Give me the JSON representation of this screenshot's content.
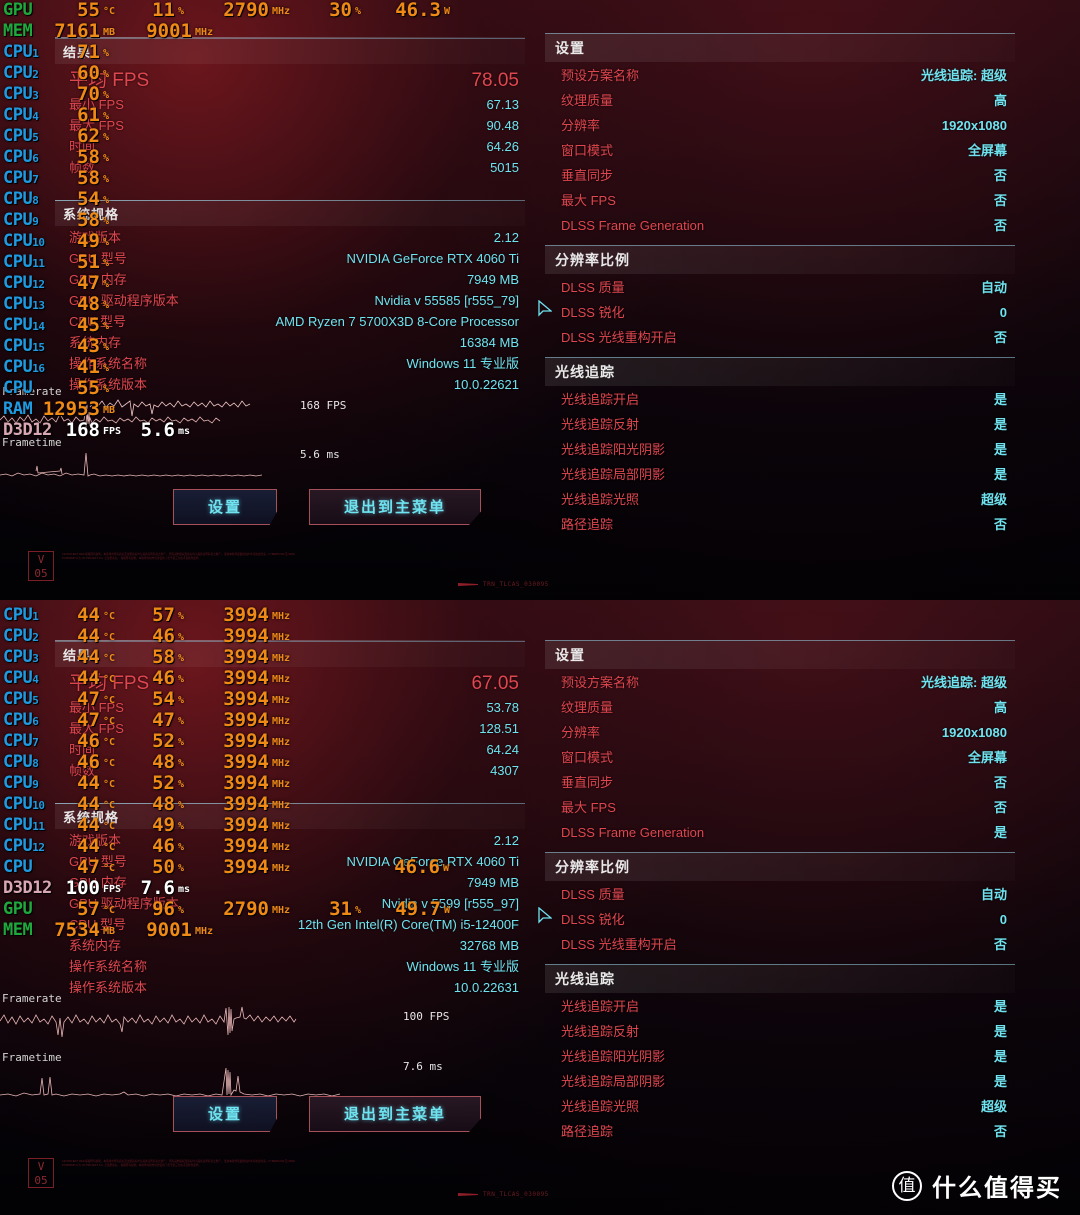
{
  "watermark": {
    "logo_glyph": "值",
    "text": "什么值得买"
  },
  "corner_tag": "TRN_TLCAS_030095",
  "v05_badge": {
    "line1": "V",
    "line2": "05"
  },
  "legal_text": "CD PROJEKT RED 保留所有权利。本游戏中所有商标及注册商标均为其各自所有者之财产。 所有其他版权及商标均为其各自所有者之财产。 使用本软件受最终用户许可协议约束。CYBERPUNK 及 MIKE PONDSMITH 为 CD PROJEKT S.A. 之注册商标。 保留所有权利。本软件的制作包含使用了若干第三方技术及软件组件。",
  "screens": [
    {
      "id": "top",
      "osd": {
        "gpu": {
          "label": "GPU",
          "temp": "55",
          "temp_unit": "°C",
          "load": "11",
          "load_unit": "%",
          "clock": "2790",
          "clock_unit": "MHz",
          "mem_load": "30",
          "mem_load_unit": "%",
          "power": "46.3",
          "power_unit": "W"
        },
        "mem": {
          "label": "MEM",
          "used": "7161",
          "used_unit": "MB",
          "clock": "9001",
          "clock_unit": "MHz"
        },
        "cpu_cores": [
          {
            "label": "CPU",
            "index": "1",
            "value": "71",
            "unit": "%"
          },
          {
            "label": "CPU",
            "index": "2",
            "value": "60",
            "unit": "%"
          },
          {
            "label": "CPU",
            "index": "3",
            "value": "70",
            "unit": "%"
          },
          {
            "label": "CPU",
            "index": "4",
            "value": "61",
            "unit": "%"
          },
          {
            "label": "CPU",
            "index": "5",
            "value": "62",
            "unit": "%"
          },
          {
            "label": "CPU",
            "index": "6",
            "value": "58",
            "unit": "%"
          },
          {
            "label": "CPU",
            "index": "7",
            "value": "58",
            "unit": "%"
          },
          {
            "label": "CPU",
            "index": "8",
            "value": "54",
            "unit": "%"
          },
          {
            "label": "CPU",
            "index": "9",
            "value": "58",
            "unit": "%"
          },
          {
            "label": "CPU",
            "index": "10",
            "value": "49",
            "unit": "%"
          },
          {
            "label": "CPU",
            "index": "11",
            "value": "51",
            "unit": "%"
          },
          {
            "label": "CPU",
            "index": "12",
            "value": "47",
            "unit": "%"
          },
          {
            "label": "CPU",
            "index": "13",
            "value": "48",
            "unit": "%"
          },
          {
            "label": "CPU",
            "index": "14",
            "value": "45",
            "unit": "%"
          },
          {
            "label": "CPU",
            "index": "15",
            "value": "43",
            "unit": "%"
          },
          {
            "label": "CPU",
            "index": "16",
            "value": "41",
            "unit": "%"
          }
        ],
        "cpu_total": {
          "label": "CPU",
          "value": "55",
          "unit": "%"
        },
        "ram": {
          "label": "RAM",
          "value": "12953",
          "unit": "MB"
        },
        "d3d": {
          "label": "D3D12",
          "fps": "168",
          "fps_unit": "FPS",
          "frametime": "5.6",
          "frametime_unit": "ms"
        },
        "framerate_label": "Framerate",
        "frametime_label": "Frametime",
        "framerate_scale": "168 FPS",
        "frametime_scale": "5.6 ms"
      },
      "benchmark": {
        "header": "结果",
        "rows": [
          {
            "k": "平均 FPS",
            "v": "78.05",
            "big": true
          },
          {
            "k": "最小 FPS",
            "v": "67.13",
            "big": false
          },
          {
            "k": "最大 FPS",
            "v": "90.48",
            "big": false
          },
          {
            "k": "时间",
            "v": "64.26",
            "big": false
          },
          {
            "k": "帧数",
            "v": "5015",
            "big": false
          }
        ]
      },
      "system": {
        "header": "系统规格",
        "rows": [
          {
            "k": "游戏版本",
            "v": "2.12"
          },
          {
            "k": "GPU 型号",
            "v": "NVIDIA GeForce RTX 4060 Ti"
          },
          {
            "k": "GPU 内存",
            "v": "7949 MB"
          },
          {
            "k": "GPU 驱动程序版本",
            "v": "Nvidia v 55585 [r555_79]"
          },
          {
            "k": "CPU 型号",
            "v": "AMD Ryzen 7 5700X3D 8-Core Processor"
          },
          {
            "k": "系统内存",
            "v": "16384 MB"
          },
          {
            "k": "操作系统名称",
            "v": "Windows 11 专业版"
          },
          {
            "k": "操作系统版本",
            "v": "10.0.22621"
          }
        ]
      },
      "settings": {
        "header": "设置",
        "rows": [
          {
            "k": "预设方案名称",
            "v": "光线追踪: 超级"
          },
          {
            "k": "纹理质量",
            "v": "高"
          },
          {
            "k": "分辨率",
            "v": "1920x1080"
          },
          {
            "k": "窗口模式",
            "v": "全屏幕"
          },
          {
            "k": "垂直同步",
            "v": "否"
          },
          {
            "k": "最大 FPS",
            "v": "否"
          },
          {
            "k": "DLSS Frame Generation",
            "v": "否"
          }
        ]
      },
      "resolution_scale": {
        "header": "分辨率比例",
        "rows": [
          {
            "k": "DLSS 质量",
            "v": "自动"
          },
          {
            "k": "DLSS 锐化",
            "v": "0"
          },
          {
            "k": "DLSS 光线重构开启",
            "v": "否"
          }
        ]
      },
      "raytracing": {
        "header": "光线追踪",
        "rows": [
          {
            "k": "光线追踪开启",
            "v": "是"
          },
          {
            "k": "光线追踪反射",
            "v": "是"
          },
          {
            "k": "光线追踪阳光阴影",
            "v": "是"
          },
          {
            "k": "光线追踪局部阴影",
            "v": "是"
          },
          {
            "k": "光线追踪光照",
            "v": "超级"
          },
          {
            "k": "路径追踪",
            "v": "否"
          }
        ]
      },
      "buttons": {
        "settings": "设置",
        "exit": "退出到主菜单"
      }
    },
    {
      "id": "bottom",
      "osd": {
        "gpu": {
          "label": "GPU",
          "temp": "57",
          "temp_unit": "°C",
          "load": "96",
          "load_unit": "%",
          "clock": "2790",
          "clock_unit": "MHz",
          "mem_load": "31",
          "mem_load_unit": "%",
          "power": "49.7",
          "power_unit": "W"
        },
        "mem": {
          "label": "MEM",
          "used": "7534",
          "used_unit": "MB",
          "clock": "9001",
          "clock_unit": "MHz"
        },
        "cpu_cores": [
          {
            "label": "CPU",
            "index": "1",
            "temp": "44",
            "temp_unit": "°C",
            "load": "57",
            "load_unit": "%",
            "clock": "3994",
            "clock_unit": "MHz"
          },
          {
            "label": "CPU",
            "index": "2",
            "temp": "44",
            "temp_unit": "°C",
            "load": "46",
            "load_unit": "%",
            "clock": "3994",
            "clock_unit": "MHz"
          },
          {
            "label": "CPU",
            "index": "3",
            "temp": "44",
            "temp_unit": "°C",
            "load": "58",
            "load_unit": "%",
            "clock": "3994",
            "clock_unit": "MHz"
          },
          {
            "label": "CPU",
            "index": "4",
            "temp": "44",
            "temp_unit": "°C",
            "load": "46",
            "load_unit": "%",
            "clock": "3994",
            "clock_unit": "MHz"
          },
          {
            "label": "CPU",
            "index": "5",
            "temp": "47",
            "temp_unit": "°C",
            "load": "54",
            "load_unit": "%",
            "clock": "3994",
            "clock_unit": "MHz"
          },
          {
            "label": "CPU",
            "index": "6",
            "temp": "47",
            "temp_unit": "°C",
            "load": "47",
            "load_unit": "%",
            "clock": "3994",
            "clock_unit": "MHz"
          },
          {
            "label": "CPU",
            "index": "7",
            "temp": "46",
            "temp_unit": "°C",
            "load": "52",
            "load_unit": "%",
            "clock": "3994",
            "clock_unit": "MHz"
          },
          {
            "label": "CPU",
            "index": "8",
            "temp": "46",
            "temp_unit": "°C",
            "load": "48",
            "load_unit": "%",
            "clock": "3994",
            "clock_unit": "MHz"
          },
          {
            "label": "CPU",
            "index": "9",
            "temp": "44",
            "temp_unit": "°C",
            "load": "52",
            "load_unit": "%",
            "clock": "3994",
            "clock_unit": "MHz"
          },
          {
            "label": "CPU",
            "index": "10",
            "temp": "44",
            "temp_unit": "°C",
            "load": "48",
            "load_unit": "%",
            "clock": "3994",
            "clock_unit": "MHz"
          },
          {
            "label": "CPU",
            "index": "11",
            "temp": "44",
            "temp_unit": "°C",
            "load": "49",
            "load_unit": "%",
            "clock": "3994",
            "clock_unit": "MHz"
          },
          {
            "label": "CPU",
            "index": "12",
            "temp": "44",
            "temp_unit": "°C",
            "load": "46",
            "load_unit": "%",
            "clock": "3994",
            "clock_unit": "MHz"
          }
        ],
        "cpu_total": {
          "label": "CPU",
          "temp": "47",
          "temp_unit": "°C",
          "load": "50",
          "load_unit": "%",
          "clock": "3994",
          "clock_unit": "MHz",
          "power": "46.6",
          "power_unit": "W"
        },
        "d3d": {
          "label": "D3D12",
          "fps": "100",
          "fps_unit": "FPS",
          "frametime": "7.6",
          "frametime_unit": "ms"
        },
        "framerate_label": "Framerate",
        "frametime_label": "Frametime",
        "framerate_scale": "100 FPS",
        "frametime_scale": "7.6 ms"
      },
      "benchmark": {
        "header": "结果",
        "rows": [
          {
            "k": "平均 FPS",
            "v": "67.05",
            "big": true
          },
          {
            "k": "最小 FPS",
            "v": "53.78",
            "big": false
          },
          {
            "k": "最大 FPS",
            "v": "128.51",
            "big": false
          },
          {
            "k": "时间",
            "v": "64.24",
            "big": false
          },
          {
            "k": "帧数",
            "v": "4307",
            "big": false
          }
        ]
      },
      "system": {
        "header": "系统规格",
        "rows": [
          {
            "k": "游戏版本",
            "v": "2.12"
          },
          {
            "k": "GPU 型号",
            "v": "NVIDIA GeForce RTX 4060 Ti"
          },
          {
            "k": "GPU 内存",
            "v": "7949 MB"
          },
          {
            "k": "GPU 驱动程序版本",
            "v": "Nvidia v 5599 [r555_97]"
          },
          {
            "k": "CPU 型号",
            "v": "12th Gen Intel(R) Core(TM) i5-12400F"
          },
          {
            "k": "系统内存",
            "v": "32768 MB"
          },
          {
            "k": "操作系统名称",
            "v": "Windows 11 专业版"
          },
          {
            "k": "操作系统版本",
            "v": "10.0.22631"
          }
        ]
      },
      "settings": {
        "header": "设置",
        "rows": [
          {
            "k": "预设方案名称",
            "v": "光线追踪: 超级"
          },
          {
            "k": "纹理质量",
            "v": "高"
          },
          {
            "k": "分辨率",
            "v": "1920x1080"
          },
          {
            "k": "窗口模式",
            "v": "全屏幕"
          },
          {
            "k": "垂直同步",
            "v": "否"
          },
          {
            "k": "最大 FPS",
            "v": "否"
          },
          {
            "k": "DLSS Frame Generation",
            "v": "是"
          }
        ]
      },
      "resolution_scale": {
        "header": "分辨率比例",
        "rows": [
          {
            "k": "DLSS 质量",
            "v": "自动"
          },
          {
            "k": "DLSS 锐化",
            "v": "0"
          },
          {
            "k": "DLSS 光线重构开启",
            "v": "否"
          }
        ]
      },
      "raytracing": {
        "header": "光线追踪",
        "rows": [
          {
            "k": "光线追踪开启",
            "v": "是"
          },
          {
            "k": "光线追踪反射",
            "v": "是"
          },
          {
            "k": "光线追踪阳光阴影",
            "v": "是"
          },
          {
            "k": "光线追踪局部阴影",
            "v": "是"
          },
          {
            "k": "光线追踪光照",
            "v": "超级"
          },
          {
            "k": "路径追踪",
            "v": "否"
          }
        ]
      },
      "buttons": {
        "settings": "设置",
        "exit": "退出到主菜单"
      }
    }
  ]
}
